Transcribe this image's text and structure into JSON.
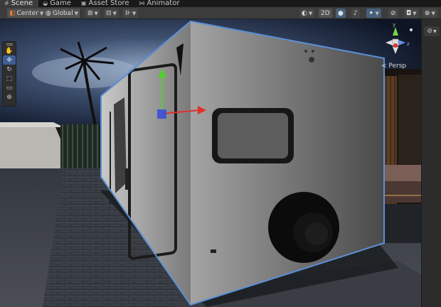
{
  "tabs": [
    {
      "label": "Scene",
      "icon": "grid-icon",
      "active": true
    },
    {
      "label": "Game",
      "icon": "gamepad-icon",
      "active": false
    },
    {
      "label": "Asset Store",
      "icon": "bag-icon",
      "active": false
    },
    {
      "label": "Animator",
      "icon": "animator-icon",
      "active": false
    }
  ],
  "toolbar": {
    "pivot_label": "Center",
    "space_label": "Global",
    "mode_2d_label": "2D"
  },
  "view": {
    "projection_label": "< Persp",
    "gizmo_labels": {
      "x": "",
      "y": "y",
      "z": "z"
    }
  },
  "colors": {
    "selection_outline": "#5b8fd6",
    "axis_x": "#e0302a",
    "axis_y": "#4fd12b",
    "axis_center": "#3b4fd8",
    "accent_blue": "#3e5f96"
  }
}
